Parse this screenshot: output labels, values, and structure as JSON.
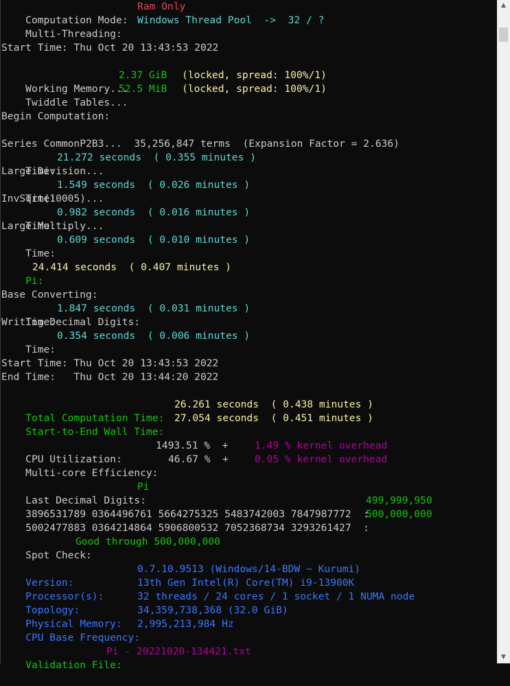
{
  "mode": {
    "label": "Computation Mode:",
    "value": "Ram Only"
  },
  "threading": {
    "label": "Multi-Threading:",
    "value": "Windows Thread Pool  ->  32 / ?"
  },
  "start_time_1": "Start Time: Thu Oct 20 13:43:53 2022",
  "memory": {
    "working_label": "Working Memory...",
    "working_value": "2.37 GiB",
    "working_note": "(locked, spread: 100%/1)",
    "twiddle_label": "Twiddle Tables...",
    "twiddle_value": "52.5 MiB",
    "twiddle_note": "(locked, spread: 100%/1)"
  },
  "begin": "Begin Computation:",
  "steps": {
    "series": "Series CommonP2B3...  35,256,847 terms  (Expansion Factor = 2.636)",
    "time_label": "Time:",
    "series_time": "21.272 seconds  ( 0.355 minutes )",
    "division": "Large Division...",
    "division_time": "1.549 seconds  ( 0.026 minutes )",
    "invsqrt": "InvSqrt(10005)...",
    "invsqrt_time": "0.982 seconds  ( 0.016 minutes )",
    "multiply": "Large Multiply...",
    "multiply_time": "0.609 seconds  ( 0.010 minutes )"
  },
  "pi": {
    "label": "Pi:",
    "value": "24.414 seconds  ( 0.407 minutes )"
  },
  "convert": {
    "base": "Base Converting:",
    "base_time": "1.847 seconds  ( 0.031 minutes )",
    "writing": "Writing Decimal Digits:",
    "writing_time": "0.354 seconds  ( 0.006 minutes )"
  },
  "times": {
    "start": "Start Time: Thu Oct 20 13:43:53 2022",
    "end": "End Time:   Thu Oct 20 13:44:20 2022"
  },
  "totals": {
    "total_label": "Total Computation Time:",
    "total_value": "26.261 seconds  ( 0.438 minutes )",
    "wall_label": "Start-to-End Wall Time:",
    "wall_value": "27.054 seconds  ( 0.451 minutes )"
  },
  "cpu": {
    "util_label": "CPU Utilization:",
    "util_value": "1493.51 %  +",
    "util_kernel": "1.49 % kernel overhead",
    "eff_label": "Multi-core Efficiency:",
    "eff_value": "46.67 %  +",
    "eff_kernel": "0.05 % kernel overhead"
  },
  "digits": {
    "label": "Last Decimal Digits:",
    "constant": "Pi",
    "row1": "3896531789 0364496761 5664275325 5483742003 7847987772  :",
    "row1_index": "499,999,950",
    "row2": "5002477883 0364214864 5906800532 7052368734 3293261427  :",
    "row2_index": "500,000,000"
  },
  "spot": {
    "label": "Spot Check:",
    "value": "Good through 500,000,000"
  },
  "info": {
    "version_label": "Version:",
    "version_value": "0.7.10.9513 (Windows/14-BDW ~ Kurumi)",
    "processor_label": "Processor(s):",
    "processor_value": "13th Gen Intel(R) Core(TM) i9-13900K",
    "topology_label": "Topology:",
    "topology_value": "32 threads / 24 cores / 1 socket / 1 NUMA node",
    "memory_label": "Physical Memory:",
    "memory_value": "34,359,738,368 (32.0 GiB)",
    "freq_label": "CPU Base Frequency:",
    "freq_value": "2,995,213,984 Hz"
  },
  "validation": {
    "label": "Validation File:",
    "value": "Pi - 20221020-134421.txt"
  },
  "scrollbar": {
    "up_icon": "▲",
    "down_icon": "▼"
  }
}
